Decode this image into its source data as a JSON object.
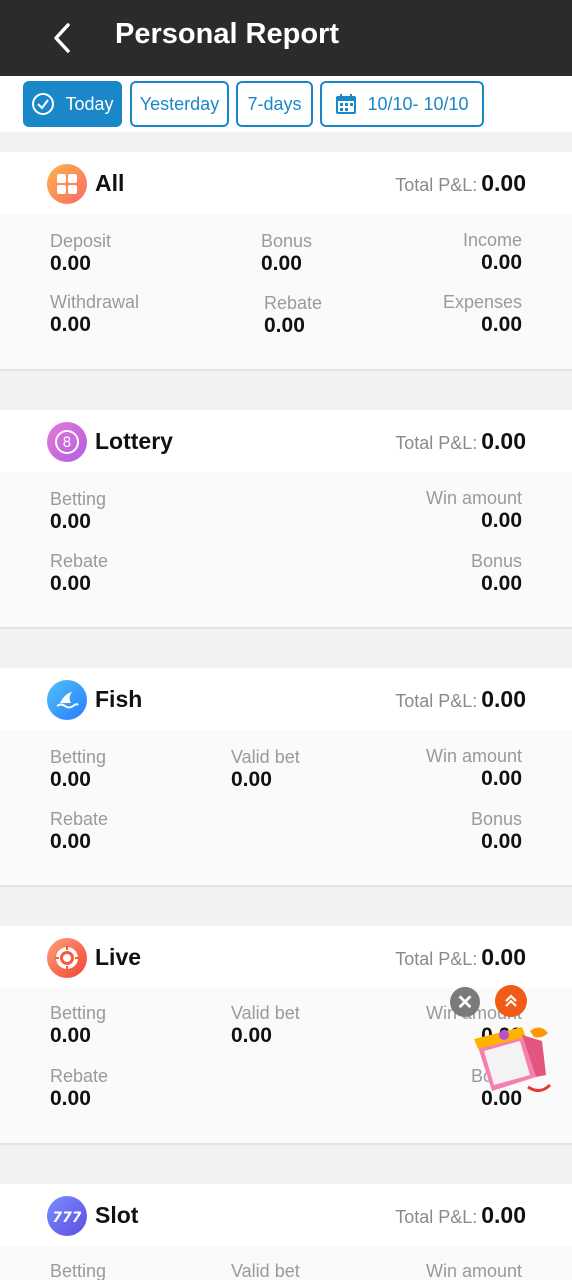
{
  "header": {
    "title": "Personal Report",
    "back_icon": "chevron-left-icon"
  },
  "filters": {
    "today": "Today",
    "yesterday": "Yesterday",
    "week": "7-days",
    "date_range": "10/10- 10/10",
    "active": "today"
  },
  "pnl_label": "Total P&L:",
  "sections": {
    "all": {
      "name": "All",
      "icon": "grid-icon",
      "total": "0.00",
      "deposit_label": "Deposit",
      "deposit": "0.00",
      "bonus_label": "Bonus",
      "bonus": "0.00",
      "income_label": "Income",
      "income": "0.00",
      "withdrawal_label": "Withdrawal",
      "withdrawal": "0.00",
      "rebate_label": "Rebate",
      "rebate": "0.00",
      "expenses_label": "Expenses",
      "expenses": "0.00"
    },
    "lottery": {
      "name": "Lottery",
      "icon": "lottery-ball-icon",
      "total": "0.00",
      "betting_label": "Betting",
      "betting": "0.00",
      "win_label": "Win amount",
      "win": "0.00",
      "rebate_label": "Rebate",
      "rebate": "0.00",
      "bonus_label": "Bonus",
      "bonus": "0.00"
    },
    "fish": {
      "name": "Fish",
      "icon": "shark-fin-icon",
      "total": "0.00",
      "betting_label": "Betting",
      "betting": "0.00",
      "valid_label": "Valid bet",
      "valid": "0.00",
      "win_label": "Win amount",
      "win": "0.00",
      "rebate_label": "Rebate",
      "rebate": "0.00",
      "bonus_label": "Bonus",
      "bonus": "0.00"
    },
    "live": {
      "name": "Live",
      "icon": "casino-chip-icon",
      "total": "0.00",
      "betting_label": "Betting",
      "betting": "0.00",
      "valid_label": "Valid bet",
      "valid": "0.00",
      "win_label": "Win amount",
      "win": "0.00",
      "rebate_label": "Rebate",
      "rebate": "0.00",
      "bonus_label": "Bonus",
      "bonus": "0.00"
    },
    "slot": {
      "name": "Slot",
      "icon": "slot-777-icon",
      "total": "0.00",
      "betting_label": "Betting",
      "valid_label": "Valid bet",
      "win_label": "Win amount"
    }
  },
  "colors": {
    "accent": "#1a87c9",
    "header_bg": "#2b2b2b",
    "float_orange": "#f25b16"
  }
}
